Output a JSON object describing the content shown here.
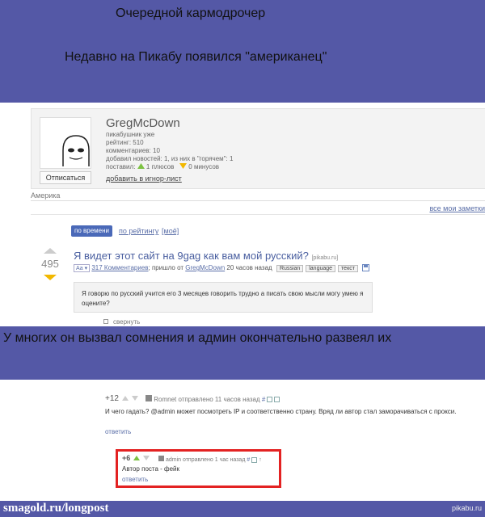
{
  "captions": {
    "top": "Очередной кармодрочер",
    "sub": "Недавно на Пикабу появился \"американец\"",
    "mid": "У многих он вызвал сомнения и админ окончательно развеял их"
  },
  "profile": {
    "username": "GregMcDown",
    "rank": "пикабушник уже",
    "rating": "рейтинг: 510",
    "comments": "комментариев: 10",
    "news": "добавил новостей: 1, из них в \"горячем\": 1",
    "voted_label": "поставил:",
    "plus": "1 плюсов",
    "minus": "0 минусов",
    "subscribe": "Отписаться",
    "ignore": "добавить в игнор-лист",
    "location": "Америка",
    "notes": "все мои заметки"
  },
  "sort": {
    "by_time": "по времени",
    "by_rating": "по рейтингу",
    "mine": "[моё]"
  },
  "post": {
    "score": "495",
    "title": "Я видет этот сайт на 9gag как вам мой русский?",
    "source": "[pikabu.ru]",
    "aa": "Аа",
    "comments_link": "317 Комментариев",
    "posted": "; пришло от",
    "author": "GregMcDown",
    "time": "20 часов назад",
    "tags": [
      "Russian",
      "language",
      "текст"
    ],
    "body": "Я говорю по русский учится его 3 месяцев говорить трудно а писать свою мысли могу умею я оцените?",
    "collapse": "свернуть"
  },
  "comment1": {
    "score": "+12",
    "meta": "Romnet отправлено 11 часов назад",
    "text": "И чего гадать? @admin может посмотреть IP и соответственно страну. Вряд ли автор стал заморачиваться с прокси.",
    "reply": "ответить"
  },
  "comment2": {
    "score": "+6",
    "meta": "admin отправлено 1 час назад",
    "text": "Автор поста - фейк",
    "reply": "ответить"
  },
  "footer": {
    "left": "smagold.ru/longpost",
    "right": "pikabu.ru"
  }
}
